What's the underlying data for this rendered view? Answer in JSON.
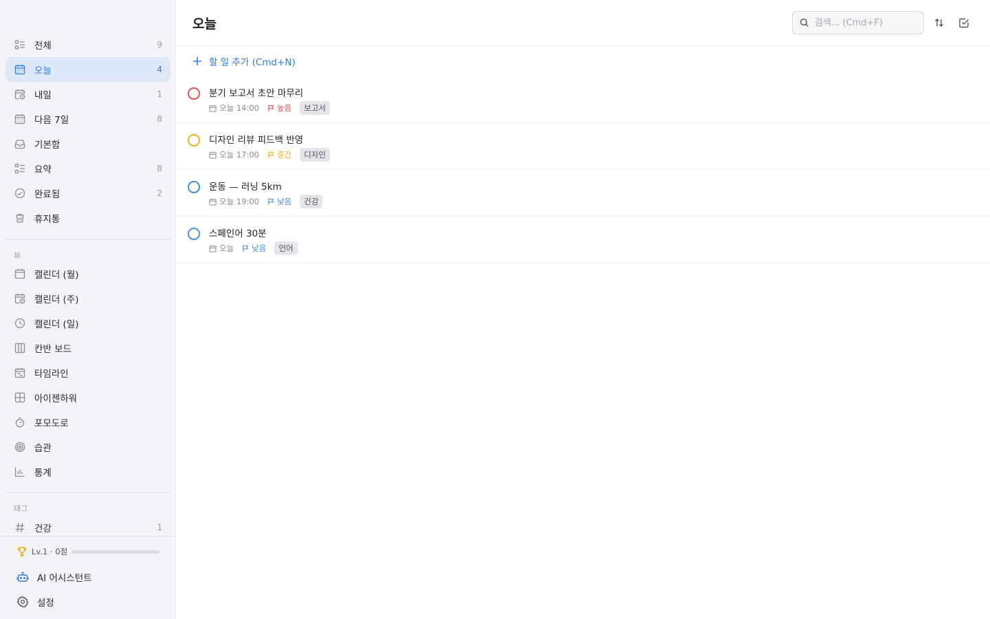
{
  "sidebar": {
    "nav": [
      {
        "label": "전체",
        "count": "9",
        "icon": "list-checks-icon"
      },
      {
        "label": "오늘",
        "count": "4",
        "icon": "calendar-today-icon",
        "active": true
      },
      {
        "label": "내일",
        "count": "1",
        "icon": "calendar-clock-icon"
      },
      {
        "label": "다음 7일",
        "count": "8",
        "icon": "calendar-week-icon"
      },
      {
        "label": "기본함",
        "count": "",
        "icon": "inbox-icon"
      },
      {
        "label": "요약",
        "count": "8",
        "icon": "summary-list-icon"
      },
      {
        "label": "완료됨",
        "count": "2",
        "icon": "check-circle-icon"
      },
      {
        "label": "휴지통",
        "count": "",
        "icon": "trash-icon"
      }
    ],
    "views_label": "뷰",
    "views": [
      {
        "label": "캘린더 (월)",
        "icon": "calendar-month-icon"
      },
      {
        "label": "캘린더 (주)",
        "icon": "calendar-week-clock-icon"
      },
      {
        "label": "캘린더 (일)",
        "icon": "clock-icon"
      },
      {
        "label": "칸반 보드",
        "icon": "kanban-icon"
      },
      {
        "label": "타임라인",
        "icon": "timeline-icon"
      },
      {
        "label": "아이젠하워",
        "icon": "matrix-icon"
      },
      {
        "label": "포모도로",
        "icon": "timer-icon"
      },
      {
        "label": "습관",
        "icon": "target-icon"
      },
      {
        "label": "통계",
        "icon": "bar-chart-icon"
      }
    ],
    "tags_label": "태그",
    "tags": [
      {
        "label": "건강",
        "count": "1",
        "icon": "hash-icon"
      }
    ],
    "level": {
      "label": "Lv.1 · 0점",
      "progress": 0.0
    },
    "ai_label": "AI 어시스턴트",
    "settings_label": "설정"
  },
  "header": {
    "title": "오늘",
    "search_placeholder": "검색... (Cmd+F)"
  },
  "add_task_label": "할 일 추가 (Cmd+N)",
  "tasks": [
    {
      "title": "분기 보고서 초안 마무리",
      "date": "오늘 14:00",
      "priority": "높음",
      "priority_color": "#e05454",
      "tag": "보고서"
    },
    {
      "title": "디자인 리뷰 피드백 반영",
      "date": "오늘 17:00",
      "priority": "중간",
      "priority_color": "#e8b21a",
      "tag": "디자인"
    },
    {
      "title": "운동 — 러닝 5km",
      "date": "오늘 19:00",
      "priority": "낮음",
      "priority_color": "#4a90d9",
      "tag": "건강"
    },
    {
      "title": "스페인어 30분",
      "date": "오늘",
      "priority": "낮음",
      "priority_color": "#4a90d9",
      "tag": "언어"
    }
  ],
  "colors": {
    "accent": "#2f7de1",
    "high": "#e05454",
    "medium": "#e8b21a",
    "low": "#4a90d9"
  }
}
